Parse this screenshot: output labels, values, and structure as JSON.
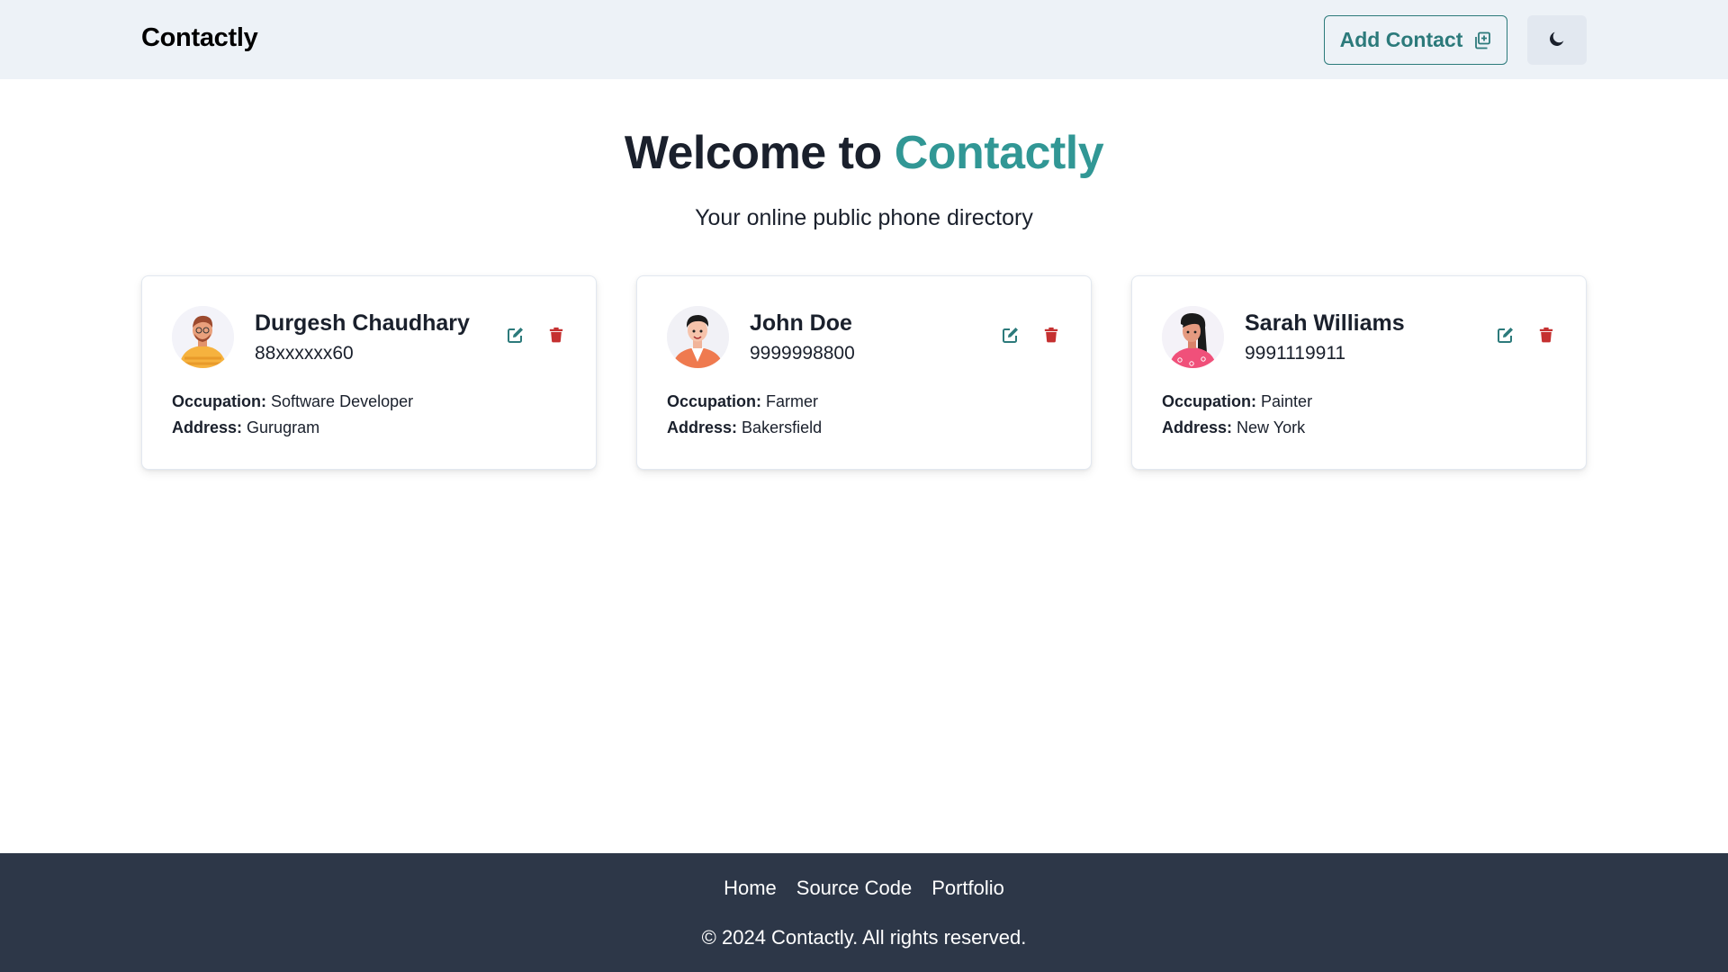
{
  "navbar": {
    "brand": "Contactly",
    "add_contact_label": "Add Contact",
    "add_contact_icon": "add-contact-icon",
    "theme_toggle_icon": "moon-icon"
  },
  "hero": {
    "title_prefix": "Welcome to",
    "title_accent": "Contactly",
    "subtitle": "Your online public phone directory"
  },
  "contacts": [
    {
      "name": "Durgesh Chaudhary",
      "phone": "88xxxxxx60",
      "occupation_label": "Occupation:",
      "occupation": "Software Developer",
      "address_label": "Address:",
      "address": "Gurugram",
      "avatar_icon": "avatar-man-beard-icon"
    },
    {
      "name": "John Doe",
      "phone": "9999998800",
      "occupation_label": "Occupation:",
      "occupation": "Farmer",
      "address_label": "Address:",
      "address": "Bakersfield",
      "avatar_icon": "avatar-man-icon"
    },
    {
      "name": "Sarah Williams",
      "phone": "9991119911",
      "occupation_label": "Occupation:",
      "occupation": "Painter",
      "address_label": "Address:",
      "address": "New York",
      "avatar_icon": "avatar-woman-icon"
    }
  ],
  "footer": {
    "links": [
      "Home",
      "Source Code",
      "Portfolio"
    ],
    "copyright": "© 2024 Contactly. All rights reserved."
  },
  "colors": {
    "accent": "#319795",
    "edit_icon": "#2c7a7b",
    "delete_icon": "#c53030",
    "navbar_bg": "#edf2f7",
    "footer_bg": "#2d3748"
  }
}
